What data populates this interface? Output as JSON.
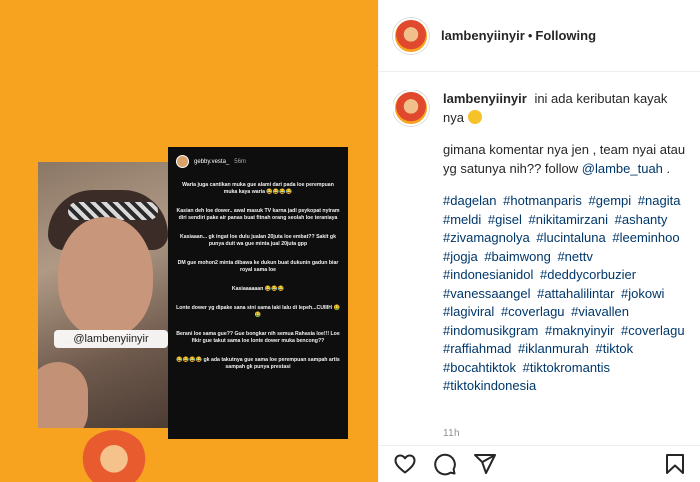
{
  "post": {
    "media": {
      "photo_tag": "@lambenyiinyir",
      "story": {
        "user": "gebby.vesta_",
        "time": "56m",
        "paragraphs": [
          "Waria juga cantikan muka gue alami dari pada loe perempuan muka kaya waria 😂😂😂😂",
          "Kasian deh loe dower.. awal masuk TV karna jadi psykopat nyiram diri sendiri pake air panas buat fitnah orang seolah loe teraniaya",
          "Kasiaaan... gk ingat loe dulu jualan 20juta loe embat?? Sakit gk punya duit wa gue minta jual 20juta gpp",
          "DM gue mohon2 minta dibawa ke dukun buat dukunin gadun biar royal sama loe",
          "Kasiaaaaaan 😂😂😂",
          "Lonte dower yg dipake sana sini sama laki lalu di lepeh...CUIIIH 🤮🤮",
          "Berani loe sama gue?? Gue bongkar nih semua Rahasia loe!!! Loe fikir gue takut sama loe lonte dower muka bencong??",
          "😂😂😂😂 gk ada takutnya gue sama loe perempuan sampah artis sampah gk punya prestasi"
        ]
      }
    },
    "header": {
      "username": "lambenyiinyir",
      "separator": "•",
      "follow_status": "Following"
    },
    "caption": {
      "username": "lambenyiinyir",
      "first_text": "ini ada keributan kayak nya",
      "body_text": "gimana komentar nya jen , team nyai atau yg satunya nih?? follow",
      "mention": "@lambe_tuah",
      "mention_after": " .",
      "hashtags": [
        "#dagelan",
        "#hotmanparis",
        "#gempi",
        "#nagita",
        "#meldi",
        "#gisel",
        "#nikitamirzani",
        "#ashanty",
        "#zivamagnolya",
        "#lucintaluna",
        "#leeminhoo",
        "#jogja",
        "#baimwong",
        "#nettv",
        "#indonesianidol",
        "#deddycorbuzier",
        "#vanessaangel",
        "#attahalilintar",
        "#jokowi",
        "#lagiviral",
        "#coverlagu",
        "#viavallen",
        "#indomusikgram",
        "#maknyinyir",
        "#coverlagu",
        "#raffiahmad",
        "#iklanmurah",
        "#tiktok",
        "#bocahtiktok",
        "#tiktokromantis",
        "#tiktokindonesia"
      ]
    },
    "time_ago": "11h",
    "actions": {
      "like_icon": "heart-icon",
      "comment_icon": "comment-icon",
      "share_icon": "share-icon",
      "save_icon": "bookmark-icon"
    },
    "colors": {
      "media_background": "#f7a320",
      "link": "#00376b"
    }
  }
}
